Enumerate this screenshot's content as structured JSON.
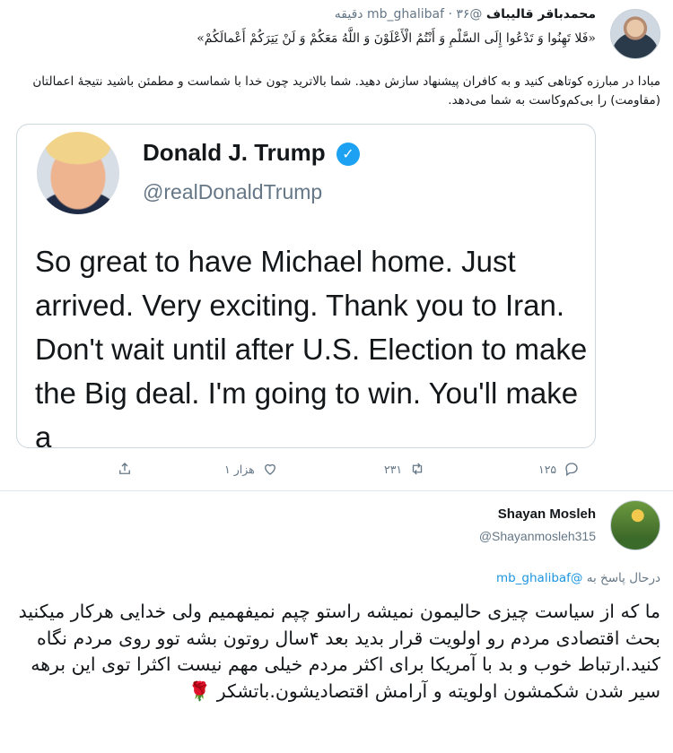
{
  "tweet1": {
    "author_name": "محمدباقر قالیباف",
    "handle": "@mb_ghalibaf",
    "separator": "·",
    "time": "۳۶ دقیقه",
    "quran": "«فَلا تَهِنُوا وَ تَدْعُوا إِلَی السَّلْمِ وَ أَنْتُمُ الْأَعْلَوْنَ وَ اللَّهُ مَعَکُمْ وَ لَنْ یَتِرَکُمْ أَعْمالَکُمْ»",
    "body": "مبادا در مبارزه کوتاهی کنید و به کافران پیشنهاد سازش دهید. شما بالاترید چون خدا با شماست و مطمئن باشید نتیجهٔ اعمالتان (مقاومت) را بی‌کم‌وکاست به شما می‌دهد.",
    "quoted": {
      "name": "Donald J. Trump",
      "handle": "@realDonaldTrump",
      "text": "So great to have Michael home. Just arrived. Very exciting. Thank you to Iran. Don't wait until after U.S. Election to make the Big deal. I'm going to win. You'll make a"
    },
    "actions": {
      "replies": "۱۲۵",
      "retweets": "۲۳۱",
      "likes": "۱ هزار"
    }
  },
  "tweet2": {
    "author_name": "Shayan Mosleh",
    "handle": "@Shayanmosleh315",
    "reply_prefix": "درحال پاسخ به",
    "reply_mention": "@mb_ghalibaf",
    "body": "ما که از سیاست چیزی حالیمون نمیشه راستو چپم نمیفهمیم ولی خدایی هرکار میکنید بحث اقتصادی مردم رو اولویت قرار بدید بعد ۴سال روتون بشه توو روی مردم نگاه کنید.ارتباط خوب و بد با آمریکا برای اکثر مردم خیلی مهم نیست اکثرا توی این برهه سیر شدن شکمشون اولویته و آرامش اقتصادیشون.باتشکر",
    "emoji": "🌹"
  },
  "icons": {
    "verified": "verified-badge-icon",
    "reply": "reply-icon",
    "retweet": "retweet-icon",
    "like": "heart-icon",
    "share": "share-icon"
  },
  "colors": {
    "text": "#14171a",
    "muted": "#657786",
    "link": "#1b95e0",
    "verified": "#1da1f2",
    "border": "#ccd6dd"
  }
}
